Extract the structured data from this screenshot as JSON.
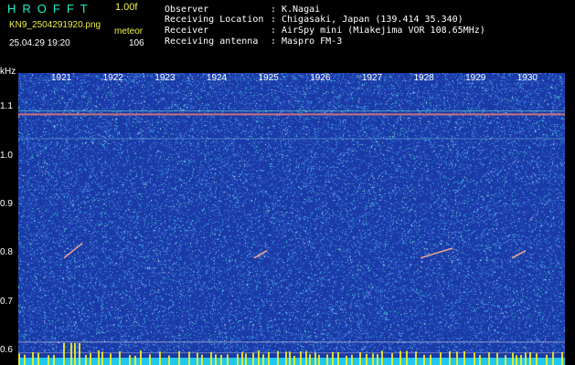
{
  "header": {
    "app_title": "HROFFT",
    "version": "1.00f",
    "filename": "KN9_2504291920.png",
    "category_label": "meteor",
    "datetime": "25.04.29 19:20",
    "count": "106"
  },
  "info": [
    {
      "label": "Observer",
      "value": "K.Nagai"
    },
    {
      "label": "Receiving Location",
      "value": "Chigasaki, Japan (139.414 35.340)"
    },
    {
      "label": "Receiver",
      "value": "AirSpy mini (Miakejima VOR 108.65MHz)"
    },
    {
      "label": "Receiving antenna",
      "value": "Maspro FM-3"
    }
  ],
  "separator": ":",
  "chart_data": {
    "type": "heatmap",
    "ylabel": "kHz",
    "time_ticks": [
      "1921",
      "1922",
      "1923",
      "1924",
      "1925",
      "1926",
      "1927",
      "1928",
      "1929",
      "1930"
    ],
    "freq_ticks": [
      "1.1",
      "1.0",
      "0.9",
      "0.8",
      "0.7",
      "0.6"
    ],
    "ylim": [
      0.57,
      1.17
    ],
    "colors": {
      "background": "#1a3aa8",
      "noise": "#3a7ae0",
      "carrier": "#e87870",
      "baseline": "#f0f020",
      "base_band": "#20c8f0"
    }
  }
}
